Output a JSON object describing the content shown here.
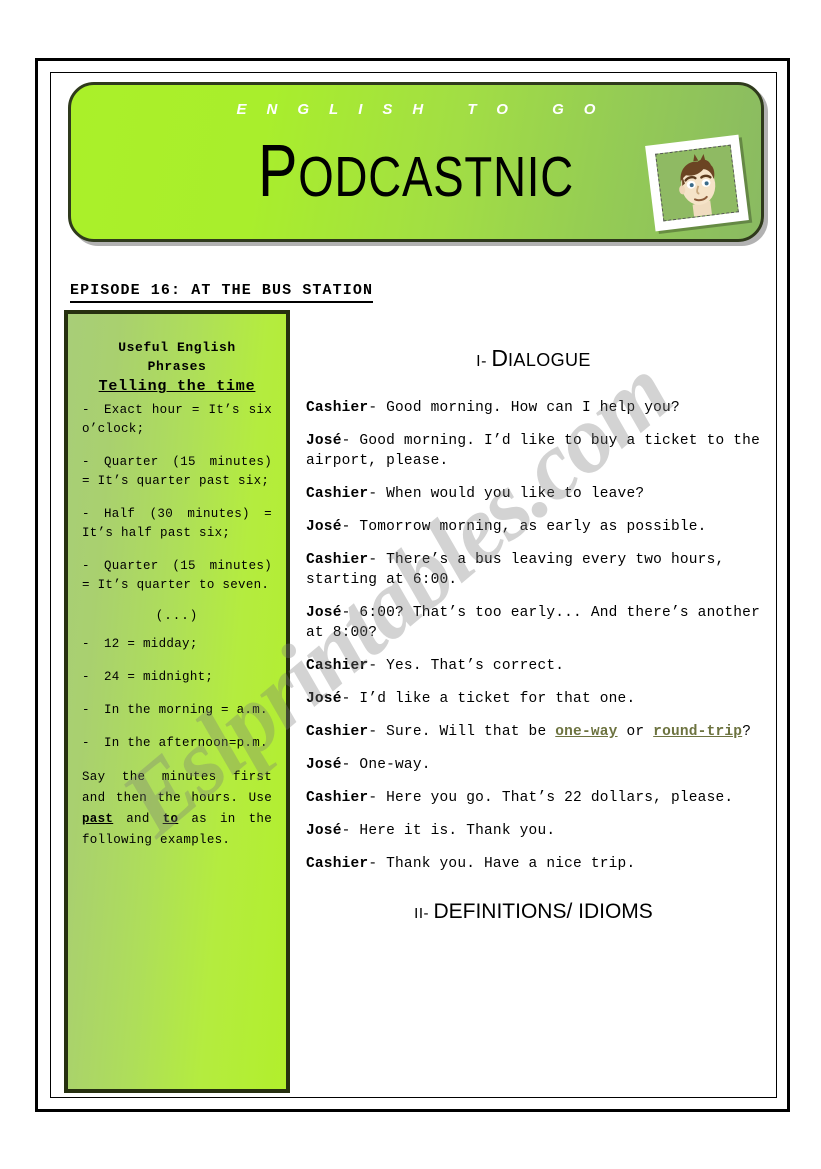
{
  "banner": {
    "kicker": "ENGLISH TO GO",
    "title_first": "P",
    "title_rest": "ODCASTNIC",
    "avatar_name": "cartoon-boy-avatar"
  },
  "watermark": {
    "text": "Eslprintables.com"
  },
  "episode": {
    "title": "EPISODE 16: AT THE BUS STATION"
  },
  "phrases_panel": {
    "head_line1": "Useful English",
    "head_line2": "Phrases",
    "subhead": "Telling the time",
    "items": [
      "Exact hour = It’s six o’clock;",
      "Quarter (15 minutes) = It’s quarter past six;",
      "Half (30 minutes) = It’s half past six;",
      "Quarter (15 minutes) = It’s quarter to seven."
    ],
    "ellipsis": "(...)",
    "items2": [
      "12 = midday;",
      "24 = midnight;",
      "In the morning = a.m.",
      "In the afternoon=p.m."
    ],
    "note_part1": "Say the minutes first and then the hours. Use ",
    "note_bold1": "past",
    "note_part2": " and ",
    "note_bold2": "to",
    "note_part3": " as in the following examples."
  },
  "dialogue": {
    "heading_numeral": "I-",
    "heading_word_first": "D",
    "heading_word_rest": "IALOGUE",
    "lines": [
      {
        "speaker": "Cashier",
        "text": "- Good morning. How can I help you?"
      },
      {
        "speaker": "José",
        "text": "- Good morning. I’d like to buy a ticket to the airport, please."
      },
      {
        "speaker": "Cashier",
        "text": "-  When would you like to leave?"
      },
      {
        "speaker": "José",
        "text": "- Tomorrow morning, as early as possible."
      },
      {
        "speaker": "Cashier",
        "text": "- There’s a bus leaving every two hours, starting at 6:00."
      },
      {
        "speaker": "José",
        "text": "- 6:00? That’s too early... And there’s another at 8:00?"
      },
      {
        "speaker": "Cashier",
        "text": "-  Yes. That’s correct."
      },
      {
        "speaker": "José",
        "text": "- I’d like a ticket for that one."
      }
    ],
    "line_ticket_type": {
      "speaker": "Cashier",
      "text_a": "- Sure. Will that be ",
      "term_a": "one-way",
      "text_b": " or ",
      "term_b": "round-trip",
      "text_c": "?"
    },
    "lines_tail": [
      {
        "speaker": "José",
        "text": "- One-way."
      },
      {
        "speaker": "Cashier",
        "text": "-  Here you go. That’s 22 dollars, please."
      },
      {
        "speaker": "José",
        "text": "- Here it is. Thank you."
      },
      {
        "speaker": "Cashier",
        "text": "- Thank you. Have a nice trip."
      }
    ]
  },
  "definitions": {
    "heading_numeral": "II-",
    "heading_word_rest": "DEFINITIONS/ IDIOMS"
  },
  "colors": {
    "banner_bright_green": "#aaf029",
    "banner_sage_green": "#8aba62",
    "panel_border": "#26300f",
    "term_olive": "#6d7340",
    "watermark_gray": "#787878"
  }
}
